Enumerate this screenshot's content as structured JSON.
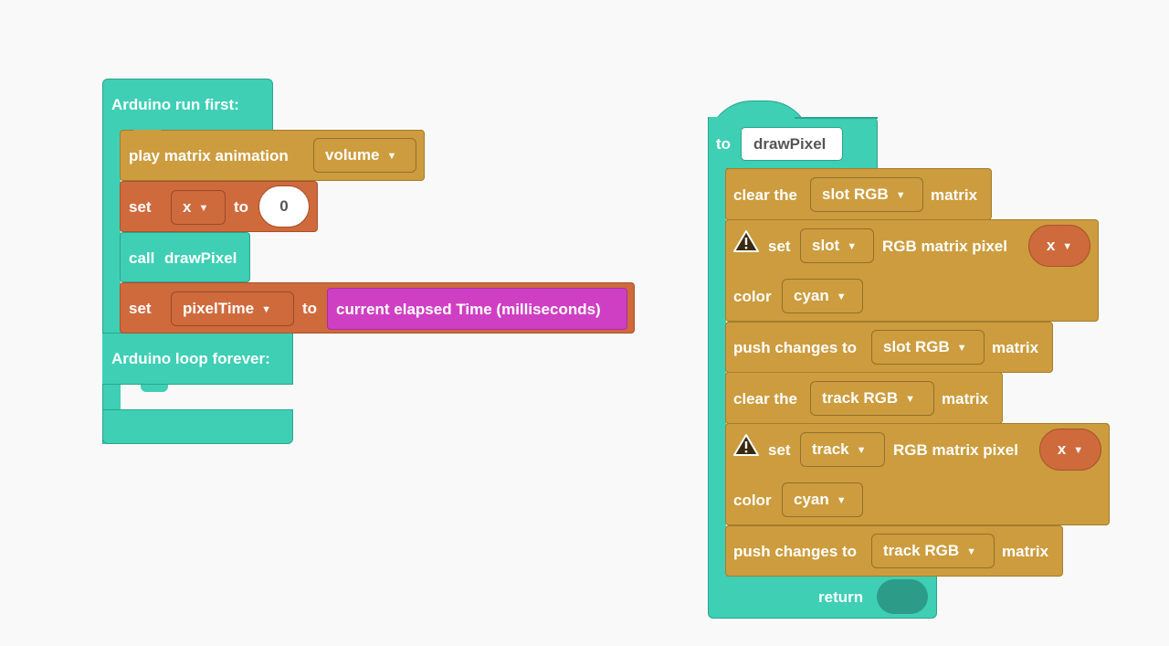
{
  "left_script": {
    "run_first_label": "Arduino run first:",
    "loop_label": "Arduino loop forever:",
    "play_block": {
      "label": "play matrix animation",
      "dropdown": "volume"
    },
    "set_x_block": {
      "set": "set",
      "variable": "x",
      "to": "to",
      "value": "0"
    },
    "call_block": {
      "label": "call",
      "name": "drawPixel"
    },
    "set_time_block": {
      "set": "set",
      "variable": "pixelTime",
      "to": "to",
      "value": "current elapsed Time (milliseconds)"
    }
  },
  "right_script": {
    "to_label": "to",
    "function_name": "drawPixel",
    "return_label": "return",
    "blocks": {
      "clear1": {
        "prefix": "clear the",
        "dropdown": "slot RGB",
        "suffix": "matrix"
      },
      "set1": {
        "set": "set",
        "dropdown": "slot",
        "middle": "RGB  matrix pixel",
        "variable": "x",
        "color_label": "color",
        "color": "cyan"
      },
      "push1": {
        "prefix": "push changes to",
        "dropdown": "slot RGB",
        "suffix": "matrix"
      },
      "clear2": {
        "prefix": "clear the",
        "dropdown": "track RGB",
        "suffix": "matrix"
      },
      "set2": {
        "set": "set",
        "dropdown": "track",
        "middle": "RGB  matrix pixel",
        "variable": "x",
        "color_label": "color",
        "color": "cyan"
      },
      "push2": {
        "prefix": "push changes to",
        "dropdown": "track RGB",
        "suffix": "matrix"
      }
    }
  },
  "colors": {
    "control_teal": "#3ecfb5",
    "matrix_gold": "#cc9c3e",
    "variable_rust": "#cf6a3c",
    "sensor_magenta": "#cf3fc3",
    "background": "#f9f9f9"
  }
}
